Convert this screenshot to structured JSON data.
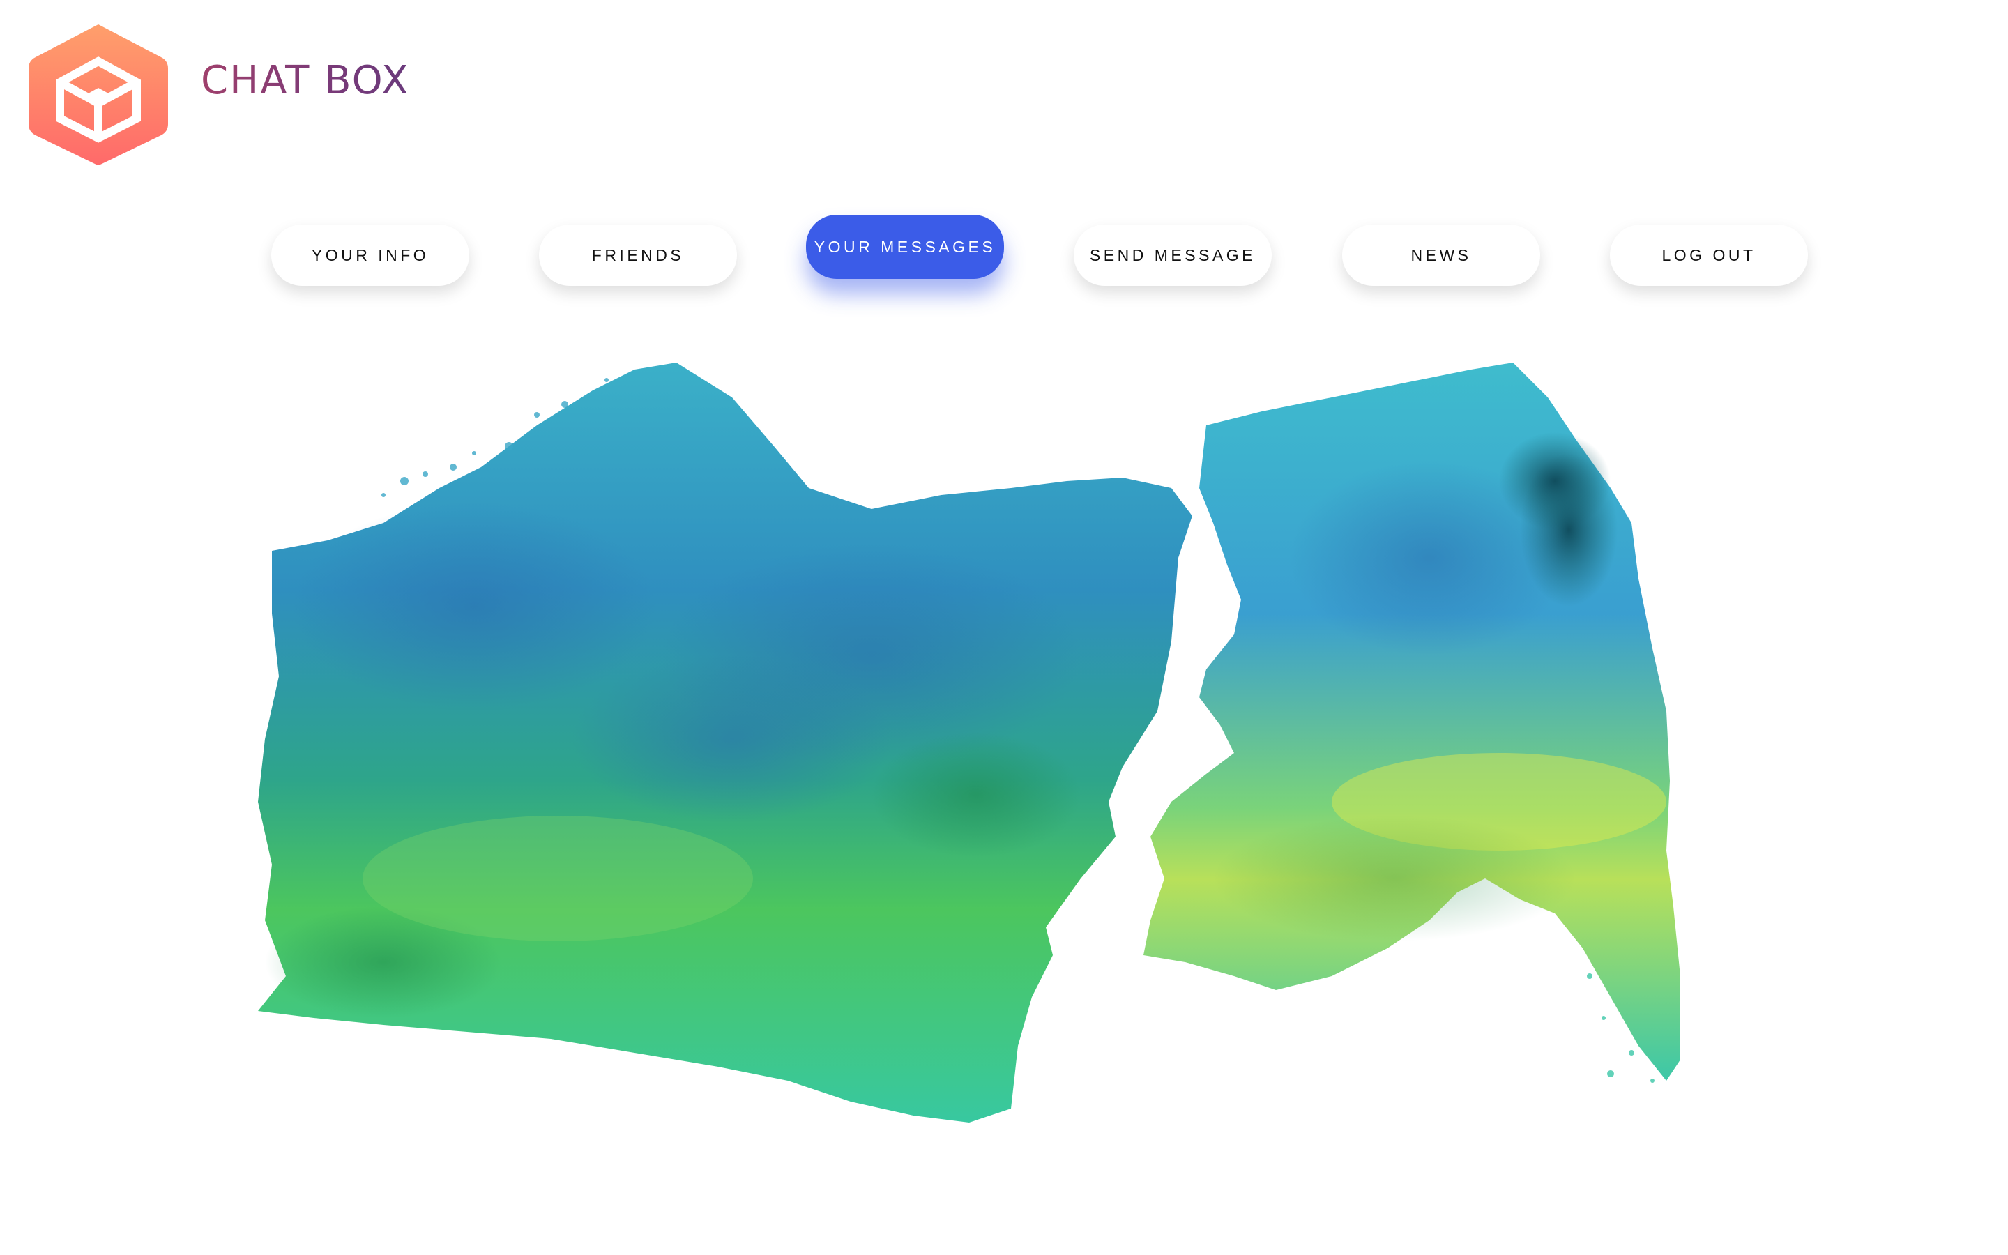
{
  "app": {
    "brand_name": "CHAT BOX",
    "logo_icon": "cube-hexagon-icon"
  },
  "nav": {
    "items": [
      {
        "label": "YOUR INFO",
        "active": false
      },
      {
        "label": "FRIENDS",
        "active": false
      },
      {
        "label": "YOUR MESSAGES",
        "active": true
      },
      {
        "label": "SEND MESSAGE",
        "active": false
      },
      {
        "label": "NEWS",
        "active": false
      },
      {
        "label": "LOG OUT",
        "active": false
      }
    ]
  },
  "theme": {
    "accent": "#3b5ce8",
    "logo_gradient_start": "#ff9a6b",
    "logo_gradient_end": "#ff6b6b",
    "brand_text": "#8a3a6e"
  },
  "hero": {
    "image": "watercolor-two-faces-illustration"
  }
}
